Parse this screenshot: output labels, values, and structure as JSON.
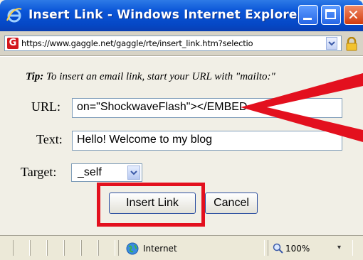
{
  "window": {
    "title": "Insert Link - Windows Internet Explorer",
    "address_url": "https://www.gaggle.net/gaggle/rte/insert_link.htm?selectio"
  },
  "dialog": {
    "tip_bold": "Tip:",
    "tip_text": " To insert an email link, start your URL with \"mailto:\"",
    "url_label": "URL:",
    "url_value": "on=\"ShockwaveFlash\"></EMBED",
    "text_label": "Text:",
    "text_value": "Hello! Welcome to my blog",
    "target_label": "Target:",
    "target_value": "_self",
    "insert_button": "Insert Link",
    "cancel_button": "Cancel"
  },
  "statusbar": {
    "zone": "Internet",
    "zoom": "100%"
  },
  "colors": {
    "titlebar": "#0b56d8",
    "annotation_red": "#e3101e",
    "dialog_bg": "#f1efe6"
  },
  "icons": [
    "ie-icon",
    "minimize-icon",
    "maximize-icon",
    "close-icon",
    "gaggle-icon",
    "dropdown-icon",
    "lock-icon",
    "globe-icon",
    "zoom-icon"
  ]
}
